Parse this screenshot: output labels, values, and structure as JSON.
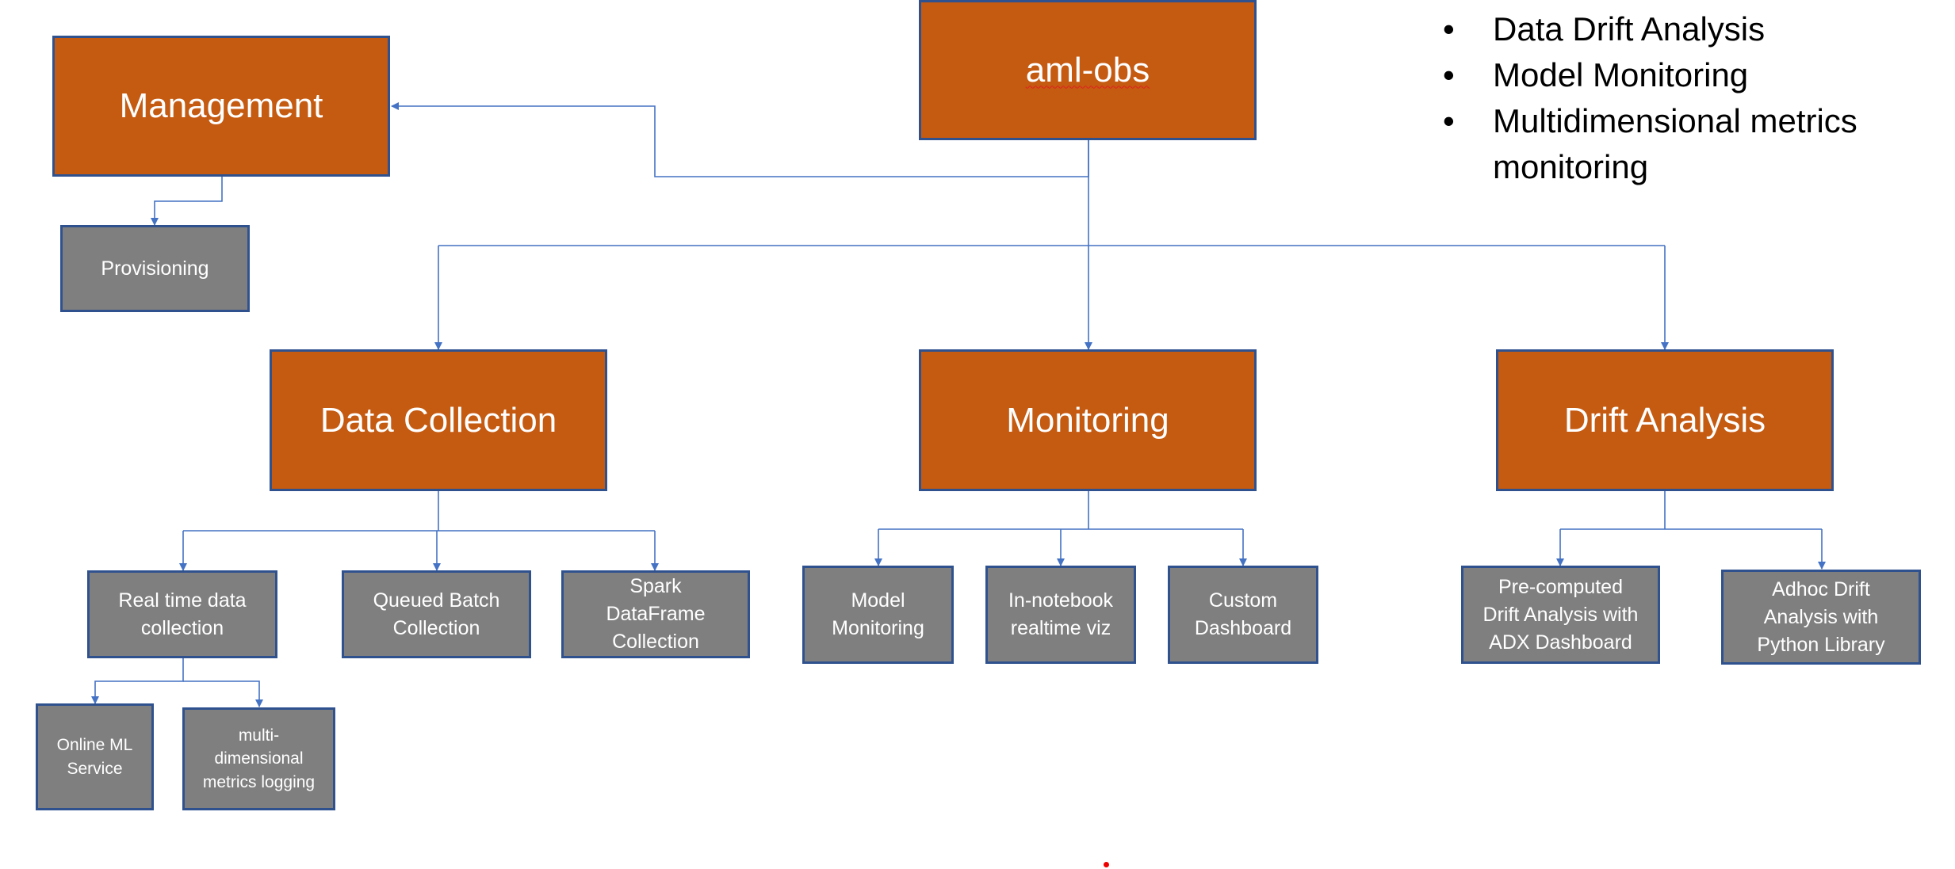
{
  "root": {
    "label": "aml-obs"
  },
  "features": [
    "Data Drift Analysis",
    "Model Monitoring",
    "Multidimensional metrics\nmonitoring"
  ],
  "management": {
    "label": "Management",
    "children": [
      "Provisioning"
    ]
  },
  "categories": [
    {
      "label": "Data Collection",
      "children": [
        "Real time data\ncollection",
        "Queued Batch\nCollection",
        "Spark\nDataFrame\nCollection"
      ]
    },
    {
      "label": "Monitoring",
      "children": [
        "Model\nMonitoring",
        "In-notebook\nrealtime viz",
        "Custom\nDashboard"
      ]
    },
    {
      "label": "Drift Analysis",
      "children": [
        "Pre-computed\nDrift Analysis with\nADX Dashboard",
        "Adhoc Drift\nAnalysis with\nPython Library"
      ]
    }
  ],
  "realtime_children": [
    "Online ML\nService",
    "multi-\ndimensional\nmetrics logging"
  ],
  "colors": {
    "category": "#c55a11",
    "leaf": "#7f7f7f",
    "border": "#2f528f",
    "connector": "#4472c4"
  }
}
